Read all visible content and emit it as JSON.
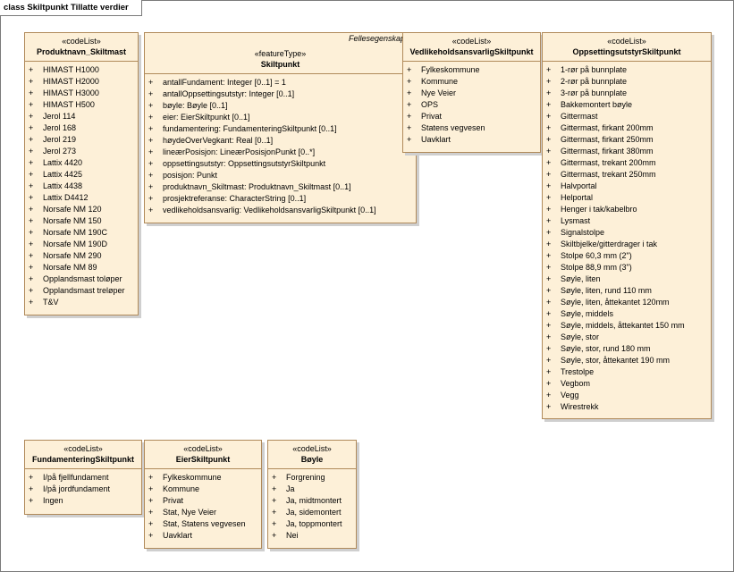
{
  "frame": {
    "title": "class Skiltpunkt Tillatte verdier"
  },
  "classes": {
    "produktnavn": {
      "stereotype": "«codeList»",
      "name": "Produktnavn_Skiltmast",
      "items": [
        "HIMAST H1000",
        "HIMAST H2000",
        "HIMAST H3000",
        "HIMAST H500",
        "Jerol 114",
        "Jerol 168",
        "Jerol 219",
        "Jerol 273",
        "Lattix 4420",
        "Lattix 4425",
        "Lattix 4438",
        "Lattix D4412",
        "Norsafe NM 120",
        "Norsafe NM 150",
        "Norsafe NM 190C",
        "Norsafe NM 190D",
        "Norsafe NM 290",
        "Norsafe NM 89",
        "Opplandsmast toløper",
        "Opplandsmast treløper",
        "T&V"
      ]
    },
    "skiltpunkt": {
      "header_note": "Fellesegenskaper",
      "stereotype": "«featureType»",
      "name": "Skiltpunkt",
      "items": [
        "antallFundament: Integer [0..1] = 1",
        "antallOppsettingsutstyr: Integer [0..1]",
        "bøyle: Bøyle [0..1]",
        "eier: EierSkiltpunkt [0..1]",
        "fundamentering: FundamenteringSkiltpunkt [0..1]",
        "høydeOverVegkant: Real [0..1]",
        "lineærPosisjon: LineærPosisjonPunkt [0..*]",
        "oppsettingsutstyr: OppsettingsutstyrSkiltpunkt",
        "posisjon: Punkt",
        "produktnavn_Skiltmast: Produktnavn_Skiltmast [0..1]",
        "prosjektreferanse: CharacterString [0..1]",
        "vedlikeholdsansvarlig: VedlikeholdsansvarligSkiltpunkt [0..1]"
      ]
    },
    "vedlikehold": {
      "stereotype": "«codeList»",
      "name": "VedlikeholdsansvarligSkiltpunkt",
      "items": [
        "Fylkeskommune",
        "Kommune",
        "Nye Veier",
        "OPS",
        "Privat",
        "Statens vegvesen",
        "Uavklart"
      ]
    },
    "oppsetting": {
      "stereotype": "«codeList»",
      "name": "OppsettingsutstyrSkiltpunkt",
      "items": [
        "1-rør på bunnplate",
        "2-rør på bunnplate",
        "3-rør på bunnplate",
        "Bakkemontert bøyle",
        "Gittermast",
        "Gittermast, firkant 200mm",
        "Gittermast, firkant 250mm",
        "Gittermast, firkant 380mm",
        "Gittermast, trekant 200mm",
        "Gittermast, trekant 250mm",
        "Halvportal",
        "Helportal",
        "Henger i tak/kabelbro",
        "Lysmast",
        "Signalstolpe",
        "Skiltbjelke/gitterdrager i tak",
        "Stolpe 60,3 mm (2\")",
        "Stolpe 88,9 mm (3\")",
        "Søyle, liten",
        "Søyle, liten, rund 110 mm",
        "Søyle, liten, åttekantet 120mm",
        "Søyle, middels",
        "Søyle, middels, åttekantet 150 mm",
        "Søyle, stor",
        "Søyle, stor, rund 180 mm",
        "Søyle, stor, åttekantet 190 mm",
        "Trestolpe",
        "Vegbom",
        "Vegg",
        "Wirestrekk"
      ]
    },
    "fundamentering": {
      "stereotype": "«codeList»",
      "name": "FundamenteringSkiltpunkt",
      "items": [
        "I/på fjellfundament",
        "I/på jordfundament",
        "Ingen"
      ]
    },
    "eier": {
      "stereotype": "«codeList»",
      "name": "EierSkiltpunkt",
      "items": [
        "Fylkeskommune",
        "Kommune",
        "Privat",
        "Stat, Nye Veier",
        "Stat, Statens vegvesen",
        "Uavklart"
      ]
    },
    "boyle": {
      "stereotype": "«codeList»",
      "name": "Bøyle",
      "items": [
        "Forgrening",
        "Ja",
        "Ja, midtmontert",
        "Ja, sidemontert",
        "Ja, toppmontert",
        "Nei"
      ]
    }
  }
}
